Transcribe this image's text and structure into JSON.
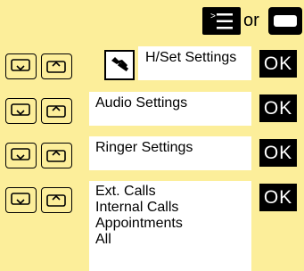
{
  "top": {
    "menu_key_icon": "menu-list-icon",
    "or_label": "or",
    "hardkey_icon": "display-key-icon"
  },
  "rows": [
    {
      "id": "hset",
      "nav_icons": [
        "nav-down-icon",
        "nav-up-icon"
      ],
      "icon": "wrench-icon",
      "label": "H/Set Settings",
      "ok_label": "OK"
    },
    {
      "id": "audio",
      "nav_icons": [
        "nav-down-icon",
        "nav-up-icon"
      ],
      "label": "Audio Settings",
      "ok_label": "OK"
    },
    {
      "id": "ringer",
      "nav_icons": [
        "nav-down-icon",
        "nav-up-icon"
      ],
      "label": "Ringer Settings",
      "ok_label": "OK"
    },
    {
      "id": "calls",
      "nav_icons": [
        "nav-down-icon",
        "nav-up-icon"
      ],
      "options": [
        "Ext. Calls",
        "Internal Calls",
        "Appointments",
        "All"
      ],
      "ok_label": "OK"
    }
  ],
  "colors": {
    "background": "#fcee9a",
    "panel": "#ffffff",
    "key": "#000000"
  }
}
